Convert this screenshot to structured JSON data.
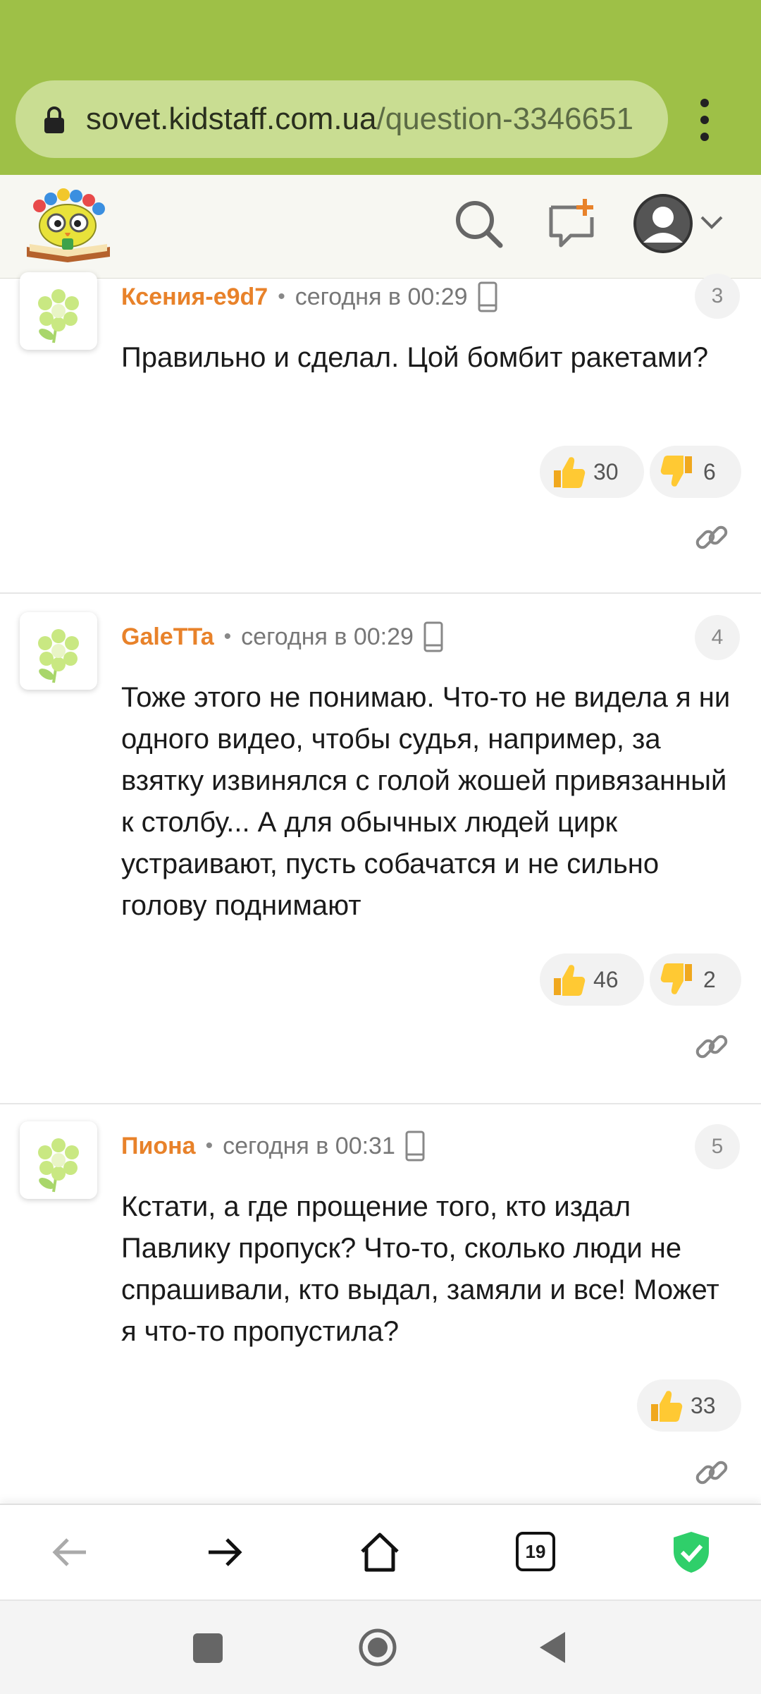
{
  "browser": {
    "url_host": "sovet.kidstaff.com.ua",
    "url_path": "/question-3346651",
    "tab_count": "19"
  },
  "comments": [
    {
      "author": "Ксения-e9d7",
      "time": "сегодня в 00:29",
      "number": "3",
      "text": "Правильно и сделал. Цой бомбит ракетами?",
      "likes": "30",
      "dislikes": "6"
    },
    {
      "author": "GaleTTa",
      "time": "сегодня в 00:29",
      "number": "4",
      "text": "Тоже этого не понимаю. Что-то не видела я ни одного видео, чтобы судья, например, за взятку извинялся с голой жошей привязанный к столбу... А для обычных людей цирк устраивают, пусть собачатся и не сильно голову поднимают",
      "likes": "46",
      "dislikes": "2"
    },
    {
      "author": "Пиона",
      "time": "сегодня в 00:31",
      "number": "5",
      "text": "Кстати, а где прощение того, кто издал Павлику пропуск? Что-то, сколько люди не спрашивали, кто выдал, замяли и все! Может я что-то пропустила?",
      "likes": "33"
    }
  ],
  "icons": {
    "like": "thumbs-up-icon",
    "dislike": "thumbs-down-icon",
    "permalink": "link-icon",
    "device": "phone-icon"
  },
  "colors": {
    "browser_bar": "#9ec047",
    "author": "#e8822a",
    "shield": "#2fcf6a"
  }
}
